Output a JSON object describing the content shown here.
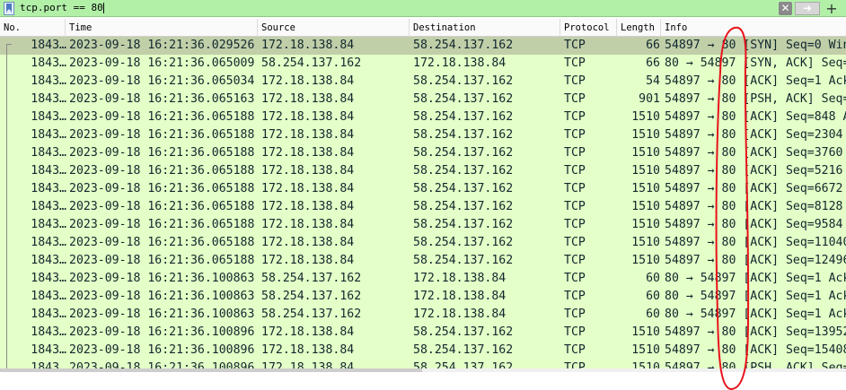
{
  "filter": {
    "expression": "tcp.port == 80",
    "clear_icon": "clear-icon",
    "apply_icon": "arrow-right-icon",
    "add_icon": "plus-icon",
    "accent_color": "#b2f0a8"
  },
  "columns": {
    "no": "No.",
    "time": "Time",
    "source": "Source",
    "destination": "Destination",
    "protocol": "Protocol",
    "length": "Length",
    "info": "Info"
  },
  "packets": [
    {
      "no": "1843…",
      "time": "2023-09-18 16:21:36.029526",
      "source": "172.18.138.84",
      "destination": "58.254.137.162",
      "protocol": "TCP",
      "length": "66",
      "info": "54897 → 80 [SYN] Seq=0 Win=",
      "selected": true
    },
    {
      "no": "1843…",
      "time": "2023-09-18 16:21:36.065009",
      "source": "58.254.137.162",
      "destination": "172.18.138.84",
      "protocol": "TCP",
      "length": "66",
      "info": "80 → 54897 [SYN, ACK] Seq=0"
    },
    {
      "no": "1843…",
      "time": "2023-09-18 16:21:36.065034",
      "source": "172.18.138.84",
      "destination": "58.254.137.162",
      "protocol": "TCP",
      "length": "54",
      "info": "54897 → 80 [ACK] Seq=1 Ack="
    },
    {
      "no": "1843…",
      "time": "2023-09-18 16:21:36.065163",
      "source": "172.18.138.84",
      "destination": "58.254.137.162",
      "protocol": "TCP",
      "length": "901",
      "info": "54897 → 80 [PSH, ACK] Seq=1"
    },
    {
      "no": "1843…",
      "time": "2023-09-18 16:21:36.065188",
      "source": "172.18.138.84",
      "destination": "58.254.137.162",
      "protocol": "TCP",
      "length": "1510",
      "info": "54897 → 80 [ACK] Seq=848 Ac"
    },
    {
      "no": "1843…",
      "time": "2023-09-18 16:21:36.065188",
      "source": "172.18.138.84",
      "destination": "58.254.137.162",
      "protocol": "TCP",
      "length": "1510",
      "info": "54897 → 80 [ACK] Seq=2304 A"
    },
    {
      "no": "1843…",
      "time": "2023-09-18 16:21:36.065188",
      "source": "172.18.138.84",
      "destination": "58.254.137.162",
      "protocol": "TCP",
      "length": "1510",
      "info": "54897 → 80 [ACK] Seq=3760 A"
    },
    {
      "no": "1843…",
      "time": "2023-09-18 16:21:36.065188",
      "source": "172.18.138.84",
      "destination": "58.254.137.162",
      "protocol": "TCP",
      "length": "1510",
      "info": "54897 → 80 [ACK] Seq=5216 A"
    },
    {
      "no": "1843…",
      "time": "2023-09-18 16:21:36.065188",
      "source": "172.18.138.84",
      "destination": "58.254.137.162",
      "protocol": "TCP",
      "length": "1510",
      "info": "54897 → 80 [ACK] Seq=6672 A"
    },
    {
      "no": "1843…",
      "time": "2023-09-18 16:21:36.065188",
      "source": "172.18.138.84",
      "destination": "58.254.137.162",
      "protocol": "TCP",
      "length": "1510",
      "info": "54897 → 80 [ACK] Seq=8128 A"
    },
    {
      "no": "1843…",
      "time": "2023-09-18 16:21:36.065188",
      "source": "172.18.138.84",
      "destination": "58.254.137.162",
      "protocol": "TCP",
      "length": "1510",
      "info": "54897 → 80 [ACK] Seq=9584 A"
    },
    {
      "no": "1843…",
      "time": "2023-09-18 16:21:36.065188",
      "source": "172.18.138.84",
      "destination": "58.254.137.162",
      "protocol": "TCP",
      "length": "1510",
      "info": "54897 → 80 [ACK] Seq=11040"
    },
    {
      "no": "1843…",
      "time": "2023-09-18 16:21:36.065188",
      "source": "172.18.138.84",
      "destination": "58.254.137.162",
      "protocol": "TCP",
      "length": "1510",
      "info": "54897 → 80 [ACK] Seq=12496"
    },
    {
      "no": "1843…",
      "time": "2023-09-18 16:21:36.100863",
      "source": "58.254.137.162",
      "destination": "172.18.138.84",
      "protocol": "TCP",
      "length": "60",
      "info": "80 → 54897 [ACK] Seq=1 Ack="
    },
    {
      "no": "1843…",
      "time": "2023-09-18 16:21:36.100863",
      "source": "58.254.137.162",
      "destination": "172.18.138.84",
      "protocol": "TCP",
      "length": "60",
      "info": "80 → 54897 [ACK] Seq=1 Ack="
    },
    {
      "no": "1843…",
      "time": "2023-09-18 16:21:36.100863",
      "source": "58.254.137.162",
      "destination": "172.18.138.84",
      "protocol": "TCP",
      "length": "60",
      "info": "80 → 54897 [ACK] Seq=1 Ack="
    },
    {
      "no": "1843…",
      "time": "2023-09-18 16:21:36.100896",
      "source": "172.18.138.84",
      "destination": "58.254.137.162",
      "protocol": "TCP",
      "length": "1510",
      "info": "54897 → 80 [ACK] Seq=13952"
    },
    {
      "no": "1843…",
      "time": "2023-09-18 16:21:36.100896",
      "source": "172.18.138.84",
      "destination": "58.254.137.162",
      "protocol": "TCP",
      "length": "1510",
      "info": "54897 → 80 [ACK] Seq=15408"
    },
    {
      "no": "1843…",
      "time": "2023-09-18 16:21:36.100896",
      "source": "172.18.138.84",
      "destination": "58.254.137.162",
      "protocol": "TCP",
      "length": "1510",
      "info": "54897 → 80 [PSH, ACK] Seq="
    }
  ],
  "colors": {
    "row_tcp": "#e4ffc7",
    "row_selected": "#c1cfa9",
    "row_text": "#12272e",
    "annotation": "#e8121b"
  }
}
